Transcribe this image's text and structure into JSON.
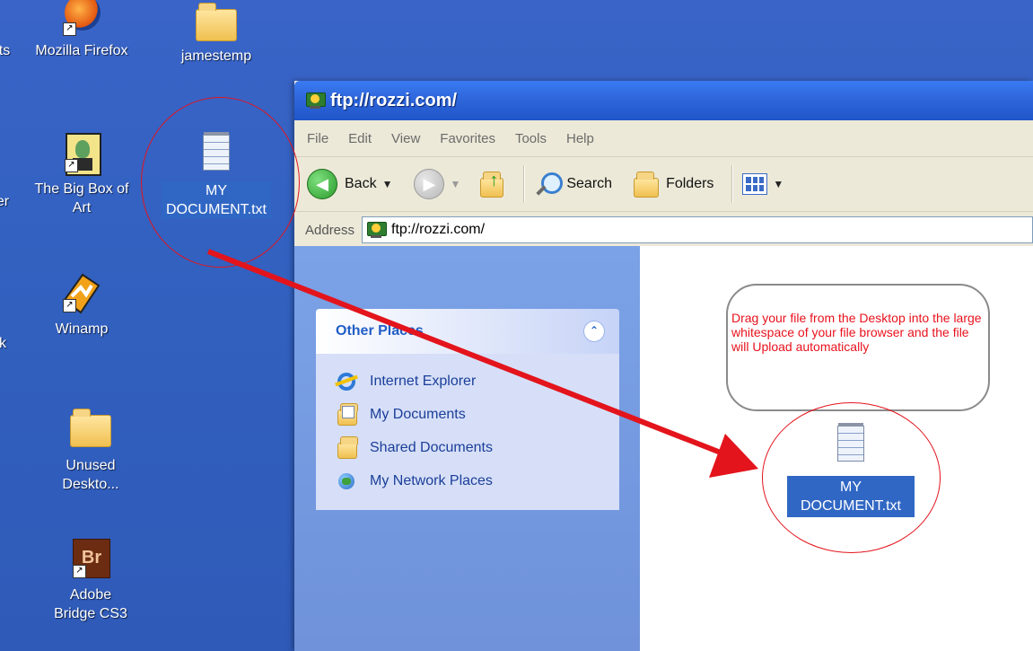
{
  "desktop": {
    "icons": [
      {
        "label": "ts"
      },
      {
        "label": "Mozilla Firefox"
      },
      {
        "label": "jamestemp"
      },
      {
        "label": "er"
      },
      {
        "label": "The Big Box of Art"
      },
      {
        "label": "MY DOCUMENT.txt"
      },
      {
        "label": "k"
      },
      {
        "label": "Winamp"
      },
      {
        "label": "Unused Deskto..."
      },
      {
        "label": "Adobe Bridge CS3",
        "badge": "Br"
      }
    ]
  },
  "window": {
    "title": "ftp://rozzi.com/",
    "menu": [
      "File",
      "Edit",
      "View",
      "Favorites",
      "Tools",
      "Help"
    ],
    "toolbar": {
      "back": "Back",
      "search": "Search",
      "folders": "Folders"
    },
    "address": {
      "label": "Address",
      "value": "ftp://rozzi.com/"
    },
    "other_places": {
      "title": "Other Places",
      "items": [
        "Internet Explorer",
        "My Documents",
        "Shared Documents",
        "My Network Places"
      ]
    },
    "callout": "Drag your file from the Desktop into the large whitespace of your file browser and the file will Upload automatically",
    "file": {
      "label": "MY DOCUMENT.txt"
    }
  },
  "colors": {
    "annotation": "#e3141c",
    "desktop": "#3261c0",
    "titlebar": "#2f67dc"
  }
}
